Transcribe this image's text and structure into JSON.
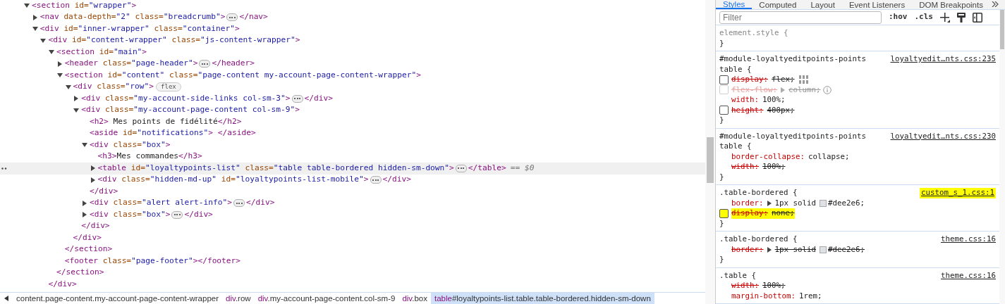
{
  "elements_panel": {
    "dom_tree": [
      {
        "kind": "element",
        "expanded": true,
        "selected": false,
        "open": [
          {
            "kind": "tag",
            "text": "<section"
          },
          {
            "kind": "attr",
            "text": " id="
          },
          {
            "kind": "value",
            "text": "\"wrapper\""
          },
          {
            "kind": "tag",
            "text": ">"
          }
        ],
        "children": [
          {
            "kind": "element",
            "expanded": false,
            "selected": false,
            "open": [
              {
                "kind": "tag",
                "text": "<nav"
              },
              {
                "kind": "attr",
                "text": " data-depth="
              },
              {
                "kind": "value",
                "text": "\"2\""
              },
              {
                "kind": "attr",
                "text": " class="
              },
              {
                "kind": "value",
                "text": "\"breadcrumb\""
              },
              {
                "kind": "tag",
                "text": ">"
              }
            ],
            "close": [
              {
                "kind": "tag",
                "text": "</nav>"
              }
            ]
          },
          {
            "kind": "element",
            "expanded": true,
            "selected": false,
            "open": [
              {
                "kind": "tag",
                "text": "<div"
              },
              {
                "kind": "attr",
                "text": " id="
              },
              {
                "kind": "value",
                "text": "\"inner-wrapper\""
              },
              {
                "kind": "attr",
                "text": " class="
              },
              {
                "kind": "value",
                "text": "\"container\""
              },
              {
                "kind": "tag",
                "text": ">"
              }
            ],
            "children": [
              {
                "kind": "element",
                "expanded": true,
                "selected": false,
                "open": [
                  {
                    "kind": "tag",
                    "text": "<div"
                  },
                  {
                    "kind": "attr",
                    "text": " id="
                  },
                  {
                    "kind": "value",
                    "text": "\"content-wrapper\""
                  },
                  {
                    "kind": "attr",
                    "text": " class="
                  },
                  {
                    "kind": "value",
                    "text": "\"js-content-wrapper\""
                  },
                  {
                    "kind": "tag",
                    "text": ">"
                  }
                ],
                "close": [
                  {
                    "kind": "tag",
                    "text": "</div>"
                  }
                ],
                "children": [
                  {
                    "kind": "element",
                    "expanded": true,
                    "selected": false,
                    "open": [
                      {
                        "kind": "tag",
                        "text": "<section"
                      },
                      {
                        "kind": "attr",
                        "text": " id="
                      },
                      {
                        "kind": "value",
                        "text": "\"main\""
                      },
                      {
                        "kind": "tag",
                        "text": ">"
                      }
                    ],
                    "close": [
                      {
                        "kind": "tag",
                        "text": "</section>"
                      }
                    ],
                    "children": [
                      {
                        "kind": "element",
                        "expanded": false,
                        "selected": false,
                        "open": [
                          {
                            "kind": "tag",
                            "text": "<header"
                          },
                          {
                            "kind": "attr",
                            "text": " class="
                          },
                          {
                            "kind": "value",
                            "text": "\"page-header\""
                          },
                          {
                            "kind": "tag",
                            "text": ">"
                          }
                        ],
                        "close": [
                          {
                            "kind": "tag",
                            "text": "</header>"
                          }
                        ]
                      },
                      {
                        "kind": "element",
                        "expanded": true,
                        "selected": false,
                        "open": [
                          {
                            "kind": "tag",
                            "text": "<section"
                          },
                          {
                            "kind": "attr",
                            "text": " id="
                          },
                          {
                            "kind": "value",
                            "text": "\"content\""
                          },
                          {
                            "kind": "attr",
                            "text": " class="
                          },
                          {
                            "kind": "value",
                            "text": "\"page-content my-account-page-content-wrapper\""
                          },
                          {
                            "kind": "tag",
                            "text": ">"
                          }
                        ],
                        "close": [
                          {
                            "kind": "tag",
                            "text": "</section>"
                          }
                        ],
                        "children": [
                          {
                            "kind": "element",
                            "expanded": true,
                            "selected": false,
                            "badge": "flex",
                            "open": [
                              {
                                "kind": "tag",
                                "text": "<div"
                              },
                              {
                                "kind": "attr",
                                "text": " class="
                              },
                              {
                                "kind": "value",
                                "text": "\"row\""
                              },
                              {
                                "kind": "tag",
                                "text": ">"
                              }
                            ],
                            "close": [
                              {
                                "kind": "tag",
                                "text": "</div>"
                              }
                            ],
                            "children": [
                              {
                                "kind": "element",
                                "expanded": false,
                                "selected": false,
                                "open": [
                                  {
                                    "kind": "tag",
                                    "text": "<div"
                                  },
                                  {
                                    "kind": "attr",
                                    "text": " class="
                                  },
                                  {
                                    "kind": "value",
                                    "text": "\"my-account-side-links col-sm-3\""
                                  },
                                  {
                                    "kind": "tag",
                                    "text": ">"
                                  }
                                ],
                                "close": [
                                  {
                                    "kind": "tag",
                                    "text": "</div>"
                                  }
                                ]
                              },
                              {
                                "kind": "element",
                                "expanded": true,
                                "selected": false,
                                "open": [
                                  {
                                    "kind": "tag",
                                    "text": "<div"
                                  },
                                  {
                                    "kind": "attr",
                                    "text": " class="
                                  },
                                  {
                                    "kind": "value",
                                    "text": "\"my-account-page-content col-sm-9\""
                                  },
                                  {
                                    "kind": "tag",
                                    "text": ">"
                                  }
                                ],
                                "close": [
                                  {
                                    "kind": "tag",
                                    "text": "</div>"
                                  }
                                ],
                                "children": [
                                  {
                                    "kind": "leaf",
                                    "selected": false,
                                    "open": [
                                      {
                                        "kind": "tag",
                                        "text": "<h2>"
                                      },
                                      {
                                        "kind": "text",
                                        "text": " Mes points de fidélité"
                                      },
                                      {
                                        "kind": "tag",
                                        "text": "</h2>"
                                      }
                                    ]
                                  },
                                  {
                                    "kind": "leaf",
                                    "selected": false,
                                    "open": [
                                      {
                                        "kind": "tag",
                                        "text": "<aside"
                                      },
                                      {
                                        "kind": "attr",
                                        "text": " id="
                                      },
                                      {
                                        "kind": "value",
                                        "text": "\"notifications\""
                                      },
                                      {
                                        "kind": "tag",
                                        "text": ">"
                                      },
                                      {
                                        "kind": "tag",
                                        "text": " </aside>"
                                      }
                                    ]
                                  },
                                  {
                                    "kind": "element",
                                    "expanded": true,
                                    "selected": false,
                                    "open": [
                                      {
                                        "kind": "tag",
                                        "text": "<div"
                                      },
                                      {
                                        "kind": "attr",
                                        "text": " class="
                                      },
                                      {
                                        "kind": "value",
                                        "text": "\"box\""
                                      },
                                      {
                                        "kind": "tag",
                                        "text": ">"
                                      }
                                    ],
                                    "close": [
                                      {
                                        "kind": "tag",
                                        "text": "</div>"
                                      }
                                    ],
                                    "children": [
                                      {
                                        "kind": "leaf",
                                        "selected": false,
                                        "open": [
                                          {
                                            "kind": "tag",
                                            "text": "<h3>"
                                          },
                                          {
                                            "kind": "text",
                                            "text": "Mes commandes"
                                          },
                                          {
                                            "kind": "tag",
                                            "text": "</h3>"
                                          }
                                        ]
                                      },
                                      {
                                        "kind": "element",
                                        "expanded": false,
                                        "selected": true,
                                        "suffix": "== $0",
                                        "open": [
                                          {
                                            "kind": "tag",
                                            "text": "<table"
                                          },
                                          {
                                            "kind": "attr",
                                            "text": " id="
                                          },
                                          {
                                            "kind": "value",
                                            "text": "\"loyaltypoints-list\""
                                          },
                                          {
                                            "kind": "attr",
                                            "text": " class="
                                          },
                                          {
                                            "kind": "value",
                                            "text": "\"table table-bordered hidden-sm-down\""
                                          },
                                          {
                                            "kind": "tag",
                                            "text": ">"
                                          }
                                        ],
                                        "close": [
                                          {
                                            "kind": "tag",
                                            "text": "</table>"
                                          }
                                        ]
                                      },
                                      {
                                        "kind": "element",
                                        "expanded": false,
                                        "selected": false,
                                        "open": [
                                          {
                                            "kind": "tag",
                                            "text": "<div"
                                          },
                                          {
                                            "kind": "attr",
                                            "text": " class="
                                          },
                                          {
                                            "kind": "value",
                                            "text": "\"hidden-md-up\""
                                          },
                                          {
                                            "kind": "attr",
                                            "text": " id="
                                          },
                                          {
                                            "kind": "value",
                                            "text": "\"loyaltypoints-list-mobile\""
                                          },
                                          {
                                            "kind": "tag",
                                            "text": ">"
                                          }
                                        ],
                                        "close": [
                                          {
                                            "kind": "tag",
                                            "text": "</div>"
                                          }
                                        ]
                                      }
                                    ]
                                  },
                                  {
                                    "kind": "element",
                                    "expanded": false,
                                    "selected": false,
                                    "open": [
                                      {
                                        "kind": "tag",
                                        "text": "<div"
                                      },
                                      {
                                        "kind": "attr",
                                        "text": " class="
                                      },
                                      {
                                        "kind": "value",
                                        "text": "\"alert alert-info\""
                                      },
                                      {
                                        "kind": "tag",
                                        "text": ">"
                                      }
                                    ],
                                    "close": [
                                      {
                                        "kind": "tag",
                                        "text": "</div>"
                                      }
                                    ]
                                  },
                                  {
                                    "kind": "element",
                                    "expanded": false,
                                    "selected": false,
                                    "open": [
                                      {
                                        "kind": "tag",
                                        "text": "<div"
                                      },
                                      {
                                        "kind": "attr",
                                        "text": " class="
                                      },
                                      {
                                        "kind": "value",
                                        "text": "\"box\""
                                      },
                                      {
                                        "kind": "tag",
                                        "text": ">"
                                      }
                                    ],
                                    "close": [
                                      {
                                        "kind": "tag",
                                        "text": "</div>"
                                      }
                                    ]
                                  }
                                ]
                              }
                            ]
                          }
                        ]
                      },
                      {
                        "kind": "leaf",
                        "selected": false,
                        "open": [
                          {
                            "kind": "tag",
                            "text": "<footer"
                          },
                          {
                            "kind": "attr",
                            "text": " class="
                          },
                          {
                            "kind": "value",
                            "text": "\"page-footer\""
                          },
                          {
                            "kind": "tag",
                            "text": ">"
                          },
                          {
                            "kind": "tag",
                            "text": "</footer>"
                          }
                        ]
                      }
                    ]
                  }
                ]
              }
            ]
          }
        ]
      }
    ],
    "breadcrumbs": [
      {
        "rest": "content.page-content.my-account-page-content-wrapper",
        "selected": false
      },
      {
        "tag": "div",
        "rest": ".row",
        "selected": false
      },
      {
        "tag": "div",
        "rest": ".my-account-page-content.col-sm-9",
        "selected": false
      },
      {
        "tag": "div",
        "rest": ".box",
        "selected": false
      },
      {
        "tag": "table",
        "rest": "#loyaltypoints-list.table.table-bordered.hidden-sm-down",
        "selected": true
      }
    ]
  },
  "styles_panel": {
    "tabs": [
      {
        "label": "Styles",
        "selected": true
      },
      {
        "label": "Computed",
        "selected": false
      },
      {
        "label": "Layout",
        "selected": false
      },
      {
        "label": "Event Listeners",
        "selected": false
      },
      {
        "label": "DOM Breakpoints",
        "selected": false
      }
    ],
    "filter": {
      "placeholder": "Filter"
    },
    "toolbar": [
      ":hov",
      ".cls"
    ],
    "rules": [
      {
        "inline": true,
        "selector": [
          "element.style {"
        ],
        "close": "}"
      },
      {
        "inline": false,
        "selector": [
          "#module-loyaltyeditpoints-points",
          "table {"
        ],
        "source": "loyaltyedit…nts.css:235",
        "source_highlighted": false,
        "props": [
          {
            "kind": "grid",
            "name": "display:",
            "value": "flex;",
            "overridden": true,
            "inactive": false,
            "checked": false
          },
          {
            "kind": "hint",
            "name": "flex-flow:",
            "value": "column;",
            "overridden": true,
            "inactive": true,
            "expandable": true,
            "checked": false
          },
          {
            "kind": "plain",
            "name": "width:",
            "value": "100%;",
            "overridden": false,
            "inactive": false
          },
          {
            "kind": "plain",
            "name": "height:",
            "value": "400px;",
            "overridden": true,
            "inactive": false,
            "checked": false
          }
        ],
        "close": "}"
      },
      {
        "inline": false,
        "selector": [
          "#module-loyaltyeditpoints-points",
          "table {"
        ],
        "source": "loyaltyedit…nts.css:230",
        "source_highlighted": false,
        "props": [
          {
            "kind": "plain",
            "name": "border-collapse:",
            "value": "collapse;",
            "overridden": false,
            "inactive": false
          },
          {
            "kind": "plain",
            "name": "width:",
            "value": "100%;",
            "overridden": true,
            "inactive": false
          }
        ],
        "close": "}"
      },
      {
        "inline": false,
        "selector": [
          ".table-bordered {"
        ],
        "source": "custom_s_1.css:1",
        "source_highlighted": true,
        "props": [
          {
            "kind": "plain",
            "name": "border:",
            "value": "1px solid",
            "expandable": true,
            "color": "#dee2e6",
            "color_text": "#dee2e6;",
            "overridden": false,
            "inactive": false
          },
          {
            "kind": "plain",
            "name": "display:",
            "value": "none;",
            "overridden": true,
            "inactive": false,
            "checked": false,
            "highlighted": true
          }
        ],
        "close": "}"
      },
      {
        "inline": false,
        "selector": [
          ".table-bordered {"
        ],
        "source": "theme.css:16",
        "source_highlighted": false,
        "props": [
          {
            "kind": "plain",
            "name": "border:",
            "value": "1px solid",
            "expandable": true,
            "color": "#dee2e6",
            "color_text": "#dee2e6;",
            "overridden": true,
            "inactive": false
          }
        ],
        "close": "}"
      },
      {
        "inline": false,
        "selector": [
          ".table {"
        ],
        "source": "theme.css:16",
        "source_highlighted": false,
        "props": [
          {
            "kind": "plain",
            "name": "width:",
            "value": "100%;",
            "overridden": true,
            "inactive": false
          },
          {
            "kind": "plain",
            "name": "margin-bottom:",
            "value": "1rem;",
            "overridden": false,
            "inactive": false
          }
        ]
      }
    ]
  }
}
